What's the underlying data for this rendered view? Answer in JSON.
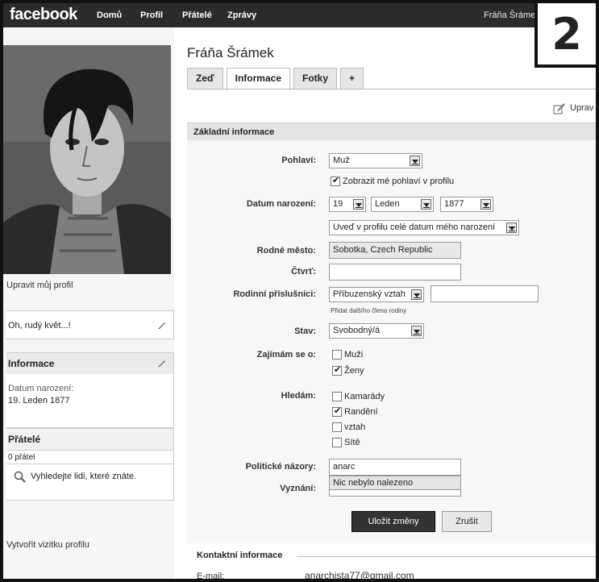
{
  "topbar": {
    "logo": "facebook",
    "nav": [
      "Domů",
      "Profil",
      "Přátelé",
      "Zprávy"
    ],
    "user": "Fráňa Šráme"
  },
  "badge": "2",
  "left": {
    "edit_profile": "Upravit můj profil",
    "status": "Oh, rudý květ...!",
    "info_header": "Informace",
    "birth_label": "Datum narození:",
    "birth_value": "19. Leden 1877",
    "friends_header": "Přátelé",
    "friends_count": "0 přátel",
    "find_people": "Vyhledejte lidi, které znáte.",
    "create_badge": "Vytvořit vizitku profilu"
  },
  "profile": {
    "name": "Fráňa Šrámek",
    "tabs": [
      "Zeď",
      "Informace",
      "Fotky",
      "+"
    ],
    "edit": "Uprav"
  },
  "basic": {
    "header": "Základní informace",
    "sex_label": "Pohlaví:",
    "sex_value": "Muž",
    "show_sex": "Zobrazit mé pohlaví v profilu",
    "birth_label": "Datum narození:",
    "birth_day": "19",
    "birth_month": "Leden",
    "birth_year": "1877",
    "birth_visibility": "Uveď v profilu celé datum mého narození",
    "hometown_label": "Rodné město:",
    "hometown_value": "Sobotka, Czech Republic",
    "district_label": "Čtvrť:",
    "family_label": "Rodinní příslušníci:",
    "family_select": "Příbuzenský vztah",
    "add_family": "Přidat dalšího člena rodiny",
    "status_label": "Stav:",
    "status_value": "Svobodný/á",
    "interest_label": "Zajímám se o:",
    "interest_men": "Muži",
    "interest_women": "Ženy",
    "looking_label": "Hledám:",
    "looking_friends": "Kamarády",
    "looking_dating": "Randění",
    "looking_relationship": "vztah",
    "looking_networking": "Sítě",
    "politics_label": "Politické názory:",
    "politics_value": "anarc",
    "politics_suggest": "Nic nebylo nalezeno",
    "religion_label": "Vyznání:",
    "save": "Uložit změny",
    "cancel": "Zrušit"
  },
  "contact": {
    "header": "Kontaktní informace",
    "email_label": "E-mail:",
    "email_value": "anarchista77@gmail.com"
  }
}
